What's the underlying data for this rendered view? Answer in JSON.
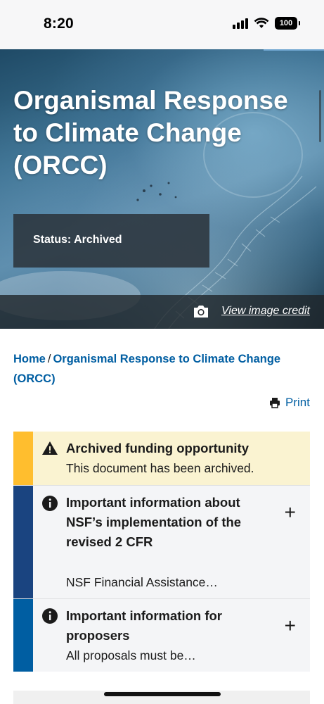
{
  "status_bar": {
    "time": "8:20",
    "battery": "100",
    "icons": [
      "signal-icon",
      "wifi-icon",
      "battery-icon"
    ]
  },
  "hero": {
    "title": "Organismal Response to Climate Change (ORCC)",
    "status": "Status: Archived",
    "image_credit_link": "View image credit",
    "icons": [
      "camera-icon"
    ]
  },
  "breadcrumb": {
    "home": "Home",
    "separator": "/",
    "current": "Organismal Response to Climate Change (ORCC)"
  },
  "print": {
    "label": "Print",
    "icon": "printer-icon"
  },
  "alerts": [
    {
      "type": "warning",
      "icon": "warning-icon",
      "title": "Archived funding opportunity",
      "text": "This document has been archived.",
      "color": "#ffbe2e"
    },
    {
      "type": "info",
      "icon": "info-icon",
      "title": "Important information about NSF’s implementation of the revised 2 CFR",
      "text": "NSF Financial Assistance…",
      "expand": "+",
      "color": "#1a4480"
    },
    {
      "type": "info",
      "icon": "info-icon",
      "title": "Important information for proposers",
      "text": "All proposals must be…",
      "expand": "+",
      "color": "#005ea2"
    }
  ],
  "colors": {
    "link": "#005ea2",
    "warning_bg": "#faf3d1",
    "info_bg": "#f4f5f7"
  }
}
